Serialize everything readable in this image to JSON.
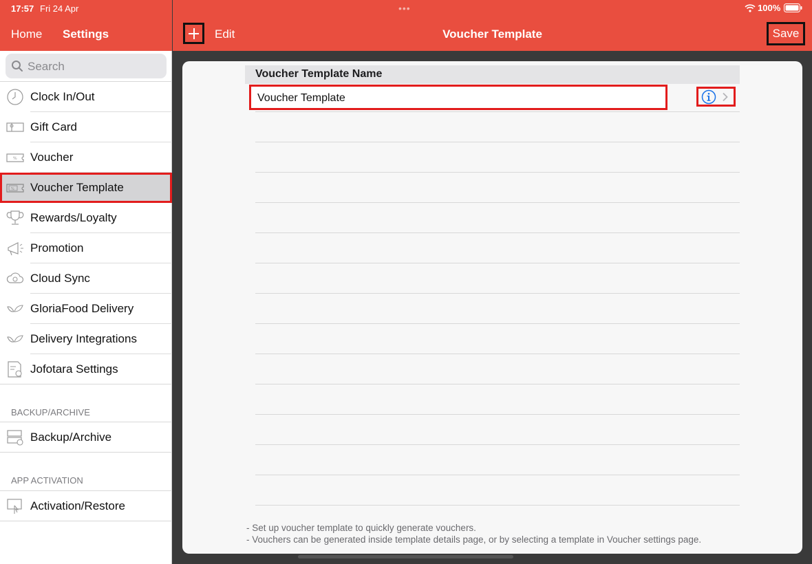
{
  "status_bar": {
    "time": "17:57",
    "date": "Fri 24 Apr",
    "battery": "100%"
  },
  "sidebar": {
    "nav": {
      "home": "Home",
      "title": "Settings"
    },
    "search": {
      "placeholder": "Search"
    },
    "items": [
      {
        "label": "Clock In/Out",
        "icon": "clock-icon"
      },
      {
        "label": "Gift Card",
        "icon": "gift-card-icon"
      },
      {
        "label": "Voucher",
        "icon": "voucher-icon"
      },
      {
        "label": "Voucher Template",
        "icon": "voucher-template-icon",
        "selected": true
      },
      {
        "label": "Rewards/Loyalty",
        "icon": "trophy-icon"
      },
      {
        "label": "Promotion",
        "icon": "megaphone-icon"
      },
      {
        "label": "Cloud Sync",
        "icon": "cloud-sync-icon"
      },
      {
        "label": "GloriaFood Delivery",
        "icon": "leaf-icon"
      },
      {
        "label": "Delivery Integrations",
        "icon": "leaf-icon"
      },
      {
        "label": "Jofotara Settings",
        "icon": "document-settings-icon"
      }
    ],
    "sections": [
      {
        "header": "BACKUP/ARCHIVE",
        "items": [
          {
            "label": "Backup/Archive",
            "icon": "backup-icon"
          }
        ]
      },
      {
        "header": "APP ACTIVATION",
        "items": [
          {
            "label": "Activation/Restore",
            "icon": "activation-icon"
          }
        ]
      }
    ]
  },
  "main": {
    "header": {
      "title": "Voucher Template",
      "edit_label": "Edit",
      "save_label": "Save",
      "add_icon": "plus-icon"
    },
    "table": {
      "column_header": "Voucher Template Name",
      "rows": [
        {
          "value": "Voucher Template"
        }
      ]
    },
    "footnotes": [
      "- Set up voucher template to quickly generate vouchers.",
      "- Vouchers can be generated inside template details page, or by selecting a template in Voucher settings page."
    ]
  },
  "colors": {
    "accent": "#e94e3f",
    "highlight": "#e21c1c",
    "info": "#1a73e8"
  }
}
